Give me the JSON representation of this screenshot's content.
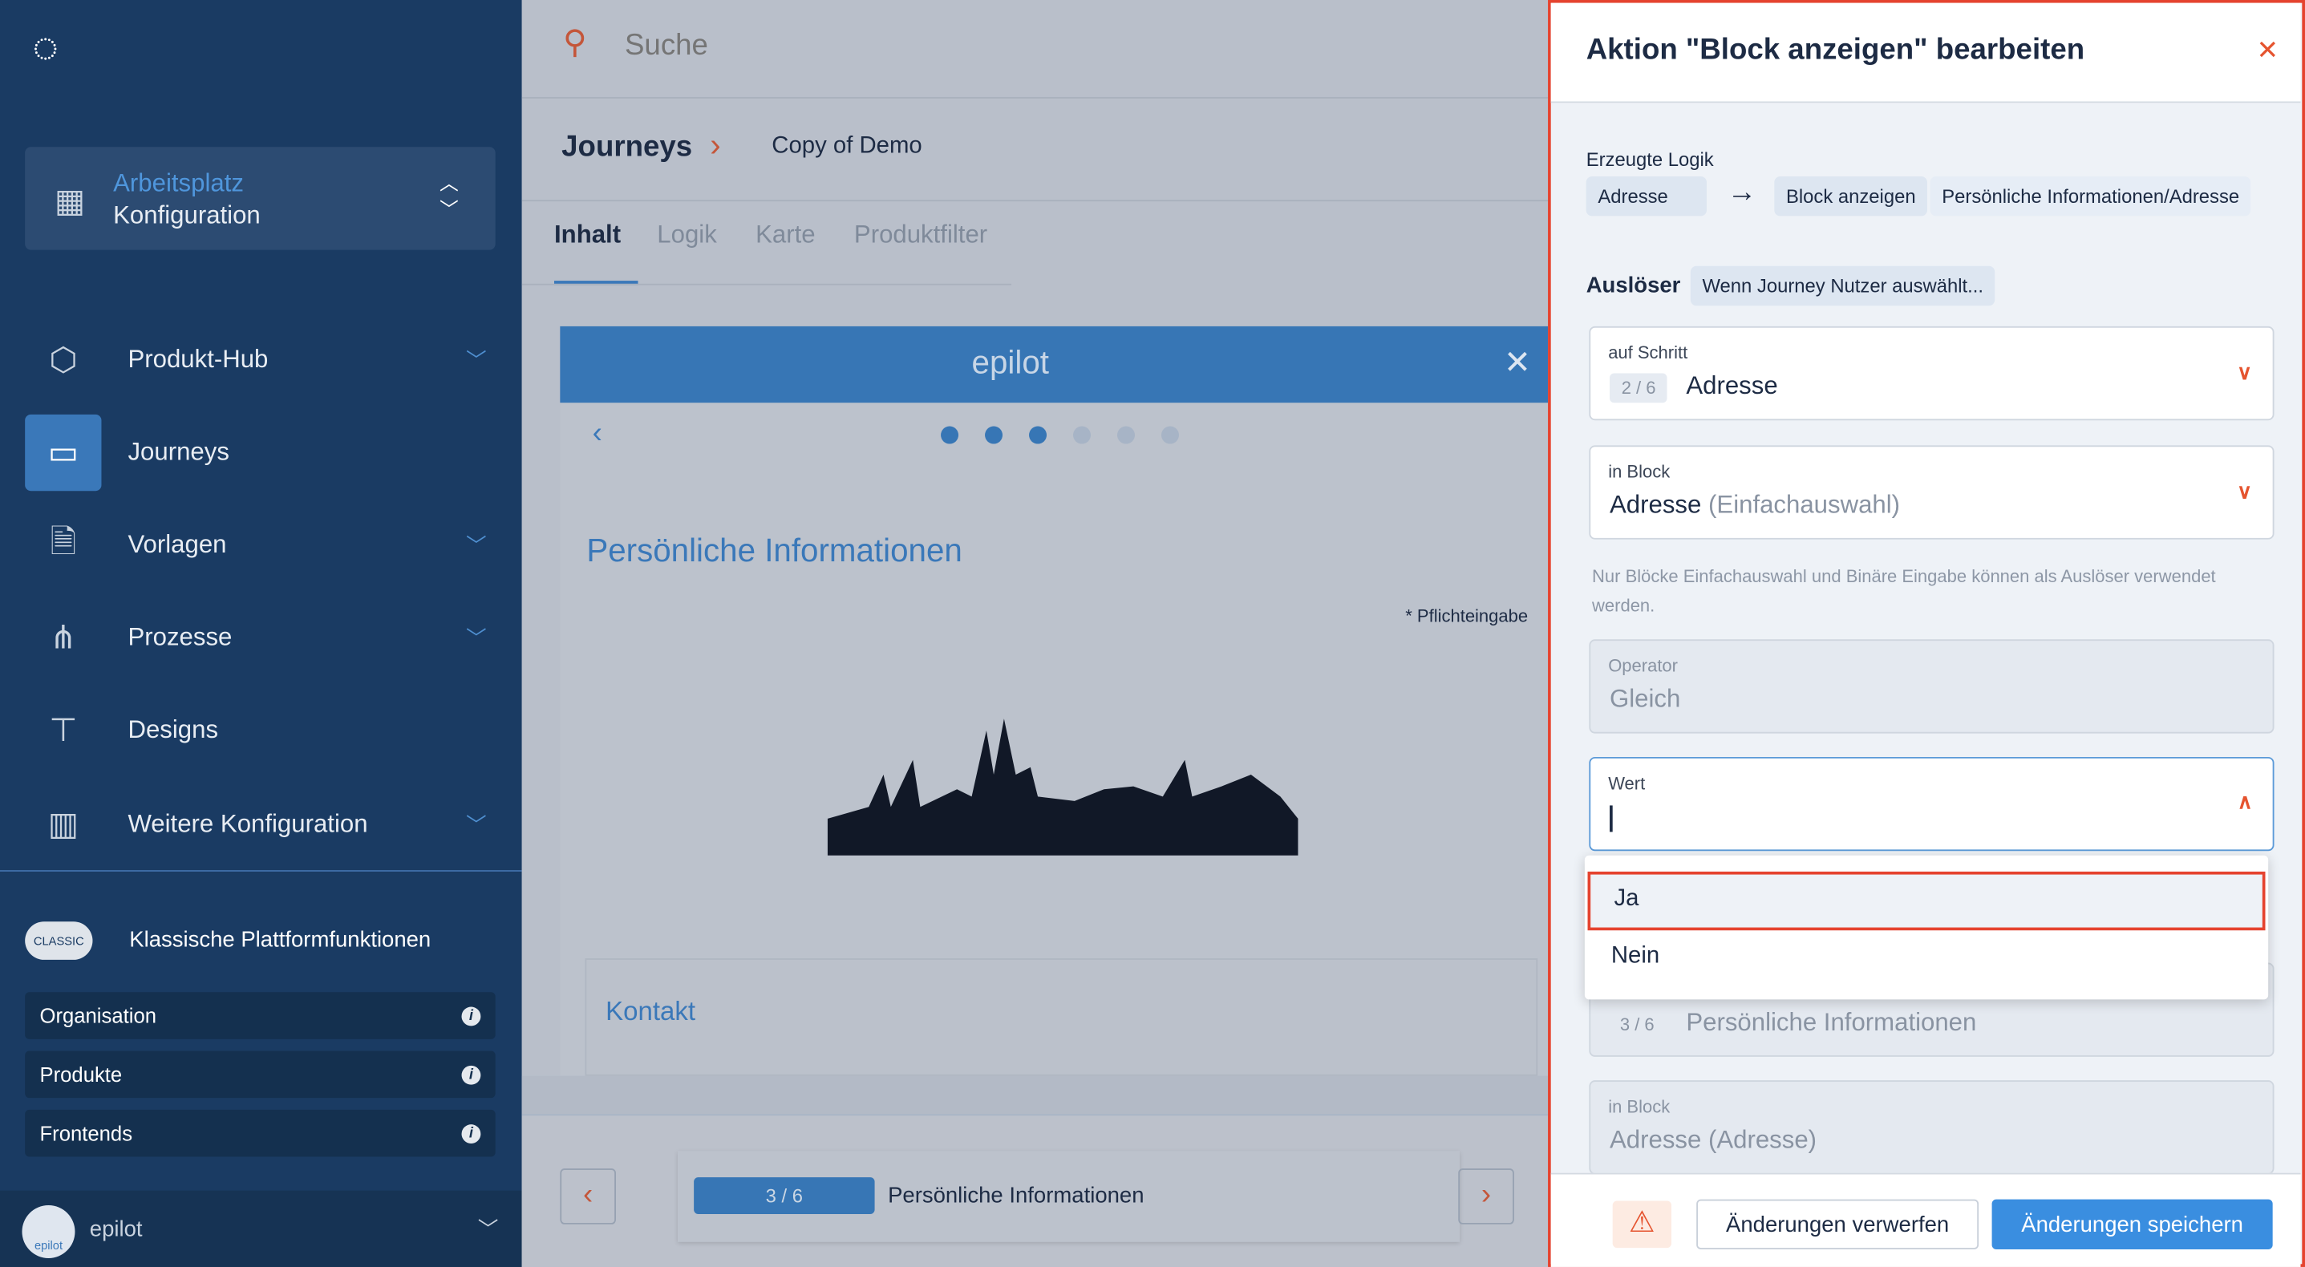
{
  "sidebar": {
    "workspace": {
      "title": "Arbeitsplatz",
      "subtitle": "Konfiguration"
    },
    "items": [
      {
        "label": "Produkt-Hub",
        "icon": "cube-icon",
        "chevron": true
      },
      {
        "label": "Journeys",
        "icon": "journey-icon",
        "active": true
      },
      {
        "label": "Vorlagen",
        "icon": "file-clip-icon",
        "chevron": true
      },
      {
        "label": "Prozesse",
        "icon": "hierarchy-icon",
        "chevron": true
      },
      {
        "label": "Designs",
        "icon": "paint-roller-icon"
      },
      {
        "label": "Weitere Konfiguration",
        "icon": "building-icon",
        "chevron": true
      }
    ],
    "classic_badge": "CLASSIC",
    "classic_title": "Klassische Plattformfunktionen",
    "classic_items": [
      "Organisation",
      "Produkte",
      "Frontends"
    ],
    "user": "epilot",
    "avatar_text": "epilot"
  },
  "search": {
    "placeholder": "Suche"
  },
  "breadcrumb": {
    "root": "Journeys",
    "current": "Copy of Demo"
  },
  "tabs": [
    "Inhalt",
    "Logik",
    "Karte",
    "Produktfilter"
  ],
  "preview": {
    "brand": "epilot",
    "heading": "Persönliche Informationen",
    "required_note": "* Pflichteingabe",
    "section": "Kontakt",
    "step_count": 6,
    "current_step": 3
  },
  "stepper": {
    "badge": "3 / 6",
    "label": "Persönliche Informationen"
  },
  "panel": {
    "title": "Aktion \"Block anzeigen\" bearbeiten",
    "logic_label": "Erzeugte Logik",
    "logic_source": "Adresse",
    "logic_action": "Block anzeigen",
    "logic_target": "Persönliche Informationen/Adresse",
    "trigger_label": "Auslöser",
    "trigger_value": "Wenn Journey Nutzer auswählt...",
    "step_field": {
      "label": "auf Schritt",
      "badge": "2 / 6",
      "value": "Adresse"
    },
    "block_field": {
      "label": "in Block",
      "value": "Adresse",
      "type": "(Einfachauswahl)"
    },
    "hint": "Nur Blöcke Einfachauswahl und Binäre Eingabe können als Auslöser verwendet werden.",
    "operator_field": {
      "label": "Operator",
      "value": "Gleich"
    },
    "value_field": {
      "label": "Wert",
      "value": ""
    },
    "options": [
      "Ja",
      "Nein"
    ],
    "target_step": {
      "badge": "3 / 6",
      "value": "Persönliche Informationen"
    },
    "target_block": {
      "label": "in Block",
      "value": "Adresse (Adresse)"
    },
    "discard": "Änderungen verwerfen",
    "save": "Änderungen speichern"
  },
  "colors": {
    "accent": "#3a78b9",
    "danger": "#e5432f",
    "sidebar": "#1a3b63"
  }
}
